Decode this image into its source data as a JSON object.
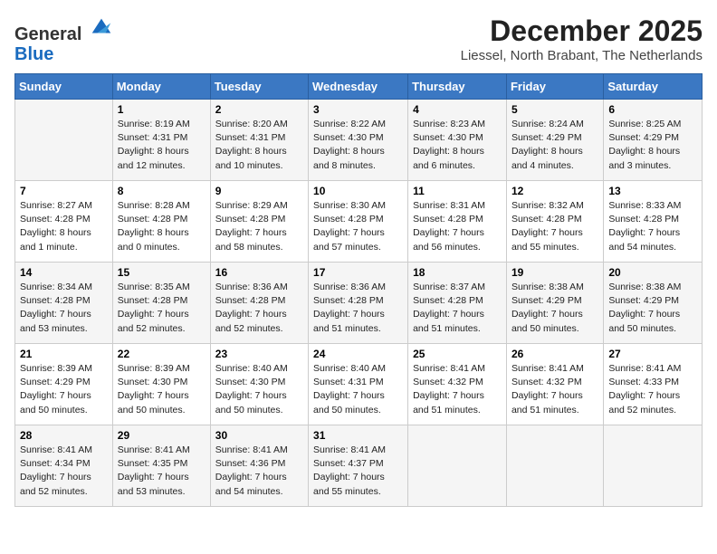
{
  "header": {
    "logo": {
      "line1": "General",
      "line2": "Blue"
    },
    "title": "December 2025",
    "location": "Liessel, North Brabant, The Netherlands"
  },
  "calendar": {
    "days_of_week": [
      "Sunday",
      "Monday",
      "Tuesday",
      "Wednesday",
      "Thursday",
      "Friday",
      "Saturday"
    ],
    "weeks": [
      [
        {
          "day": "",
          "content": ""
        },
        {
          "day": "1",
          "content": "Sunrise: 8:19 AM\nSunset: 4:31 PM\nDaylight: 8 hours\nand 12 minutes."
        },
        {
          "day": "2",
          "content": "Sunrise: 8:20 AM\nSunset: 4:31 PM\nDaylight: 8 hours\nand 10 minutes."
        },
        {
          "day": "3",
          "content": "Sunrise: 8:22 AM\nSunset: 4:30 PM\nDaylight: 8 hours\nand 8 minutes."
        },
        {
          "day": "4",
          "content": "Sunrise: 8:23 AM\nSunset: 4:30 PM\nDaylight: 8 hours\nand 6 minutes."
        },
        {
          "day": "5",
          "content": "Sunrise: 8:24 AM\nSunset: 4:29 PM\nDaylight: 8 hours\nand 4 minutes."
        },
        {
          "day": "6",
          "content": "Sunrise: 8:25 AM\nSunset: 4:29 PM\nDaylight: 8 hours\nand 3 minutes."
        }
      ],
      [
        {
          "day": "7",
          "content": "Sunrise: 8:27 AM\nSunset: 4:28 PM\nDaylight: 8 hours\nand 1 minute."
        },
        {
          "day": "8",
          "content": "Sunrise: 8:28 AM\nSunset: 4:28 PM\nDaylight: 8 hours\nand 0 minutes."
        },
        {
          "day": "9",
          "content": "Sunrise: 8:29 AM\nSunset: 4:28 PM\nDaylight: 7 hours\nand 58 minutes."
        },
        {
          "day": "10",
          "content": "Sunrise: 8:30 AM\nSunset: 4:28 PM\nDaylight: 7 hours\nand 57 minutes."
        },
        {
          "day": "11",
          "content": "Sunrise: 8:31 AM\nSunset: 4:28 PM\nDaylight: 7 hours\nand 56 minutes."
        },
        {
          "day": "12",
          "content": "Sunrise: 8:32 AM\nSunset: 4:28 PM\nDaylight: 7 hours\nand 55 minutes."
        },
        {
          "day": "13",
          "content": "Sunrise: 8:33 AM\nSunset: 4:28 PM\nDaylight: 7 hours\nand 54 minutes."
        }
      ],
      [
        {
          "day": "14",
          "content": "Sunrise: 8:34 AM\nSunset: 4:28 PM\nDaylight: 7 hours\nand 53 minutes."
        },
        {
          "day": "15",
          "content": "Sunrise: 8:35 AM\nSunset: 4:28 PM\nDaylight: 7 hours\nand 52 minutes."
        },
        {
          "day": "16",
          "content": "Sunrise: 8:36 AM\nSunset: 4:28 PM\nDaylight: 7 hours\nand 52 minutes."
        },
        {
          "day": "17",
          "content": "Sunrise: 8:36 AM\nSunset: 4:28 PM\nDaylight: 7 hours\nand 51 minutes."
        },
        {
          "day": "18",
          "content": "Sunrise: 8:37 AM\nSunset: 4:28 PM\nDaylight: 7 hours\nand 51 minutes."
        },
        {
          "day": "19",
          "content": "Sunrise: 8:38 AM\nSunset: 4:29 PM\nDaylight: 7 hours\nand 50 minutes."
        },
        {
          "day": "20",
          "content": "Sunrise: 8:38 AM\nSunset: 4:29 PM\nDaylight: 7 hours\nand 50 minutes."
        }
      ],
      [
        {
          "day": "21",
          "content": "Sunrise: 8:39 AM\nSunset: 4:29 PM\nDaylight: 7 hours\nand 50 minutes."
        },
        {
          "day": "22",
          "content": "Sunrise: 8:39 AM\nSunset: 4:30 PM\nDaylight: 7 hours\nand 50 minutes."
        },
        {
          "day": "23",
          "content": "Sunrise: 8:40 AM\nSunset: 4:30 PM\nDaylight: 7 hours\nand 50 minutes."
        },
        {
          "day": "24",
          "content": "Sunrise: 8:40 AM\nSunset: 4:31 PM\nDaylight: 7 hours\nand 50 minutes."
        },
        {
          "day": "25",
          "content": "Sunrise: 8:41 AM\nSunset: 4:32 PM\nDaylight: 7 hours\nand 51 minutes."
        },
        {
          "day": "26",
          "content": "Sunrise: 8:41 AM\nSunset: 4:32 PM\nDaylight: 7 hours\nand 51 minutes."
        },
        {
          "day": "27",
          "content": "Sunrise: 8:41 AM\nSunset: 4:33 PM\nDaylight: 7 hours\nand 52 minutes."
        }
      ],
      [
        {
          "day": "28",
          "content": "Sunrise: 8:41 AM\nSunset: 4:34 PM\nDaylight: 7 hours\nand 52 minutes."
        },
        {
          "day": "29",
          "content": "Sunrise: 8:41 AM\nSunset: 4:35 PM\nDaylight: 7 hours\nand 53 minutes."
        },
        {
          "day": "30",
          "content": "Sunrise: 8:41 AM\nSunset: 4:36 PM\nDaylight: 7 hours\nand 54 minutes."
        },
        {
          "day": "31",
          "content": "Sunrise: 8:41 AM\nSunset: 4:37 PM\nDaylight: 7 hours\nand 55 minutes."
        },
        {
          "day": "",
          "content": ""
        },
        {
          "day": "",
          "content": ""
        },
        {
          "day": "",
          "content": ""
        }
      ]
    ]
  }
}
